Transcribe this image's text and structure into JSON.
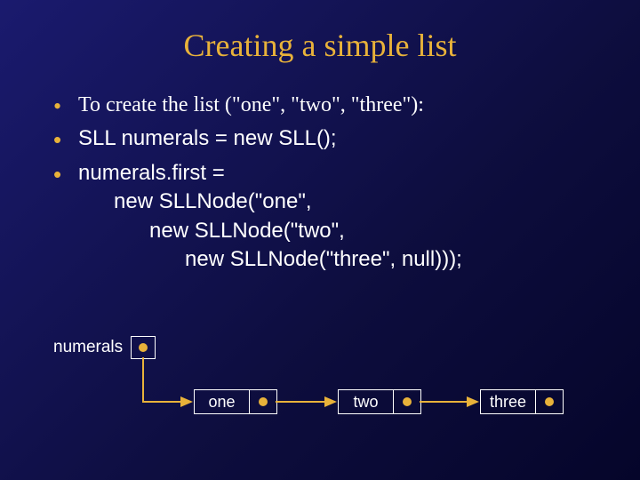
{
  "title": "Creating a simple list",
  "bullets": {
    "b1": "To create the list (\"one\", \"two\", \"three\"):",
    "b2": "SLL numerals = new SLL();",
    "b3_l1": "numerals.first =",
    "b3_l2": "new SLLNode(\"one\",",
    "b3_l3": "new SLLNode(\"two\",",
    "b3_l4": "new SLLNode(\"three\", null)));"
  },
  "diagram": {
    "head_label": "numerals",
    "nodes": [
      "one",
      "two",
      "three"
    ]
  },
  "colors": {
    "accent": "#e8b23a",
    "bg_from": "#1a1a6e",
    "bg_to": "#05052a"
  }
}
